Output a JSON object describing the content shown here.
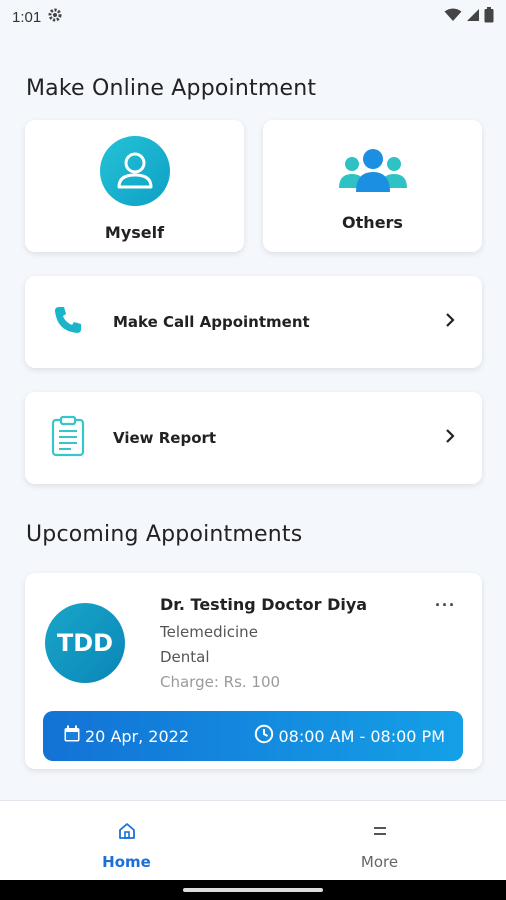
{
  "status_bar": {
    "time": "1:01",
    "icons": [
      "gear-icon",
      "wifi-icon",
      "signal-icon",
      "battery-icon"
    ]
  },
  "sections": {
    "make_online": "Make Online Appointment",
    "upcoming": "Upcoming Appointments"
  },
  "tiles": [
    {
      "label": "Myself",
      "icon": "person-icon"
    },
    {
      "label": "Others",
      "icon": "group-icon"
    }
  ],
  "rows": [
    {
      "label": "Make Call Appointment",
      "icon": "phone-icon"
    },
    {
      "label": "View Report",
      "icon": "clipboard-icon"
    }
  ],
  "appointment": {
    "initials": "TDD",
    "doctor": "Dr. Testing Doctor Diya",
    "type": "Telemedicine",
    "department": "Dental",
    "charge": "Charge: Rs. 100",
    "date": "20 Apr, 2022",
    "time": "08:00 AM - 08:00 PM",
    "more": "···"
  },
  "nav": [
    {
      "label": "Home",
      "icon": "home-icon",
      "active": true
    },
    {
      "label": "More",
      "icon": "menu-icon",
      "active": false
    }
  ],
  "colors": {
    "accent": "#1c6fd6",
    "teal": "#1ab5c9",
    "background": "#f4f7fc"
  }
}
